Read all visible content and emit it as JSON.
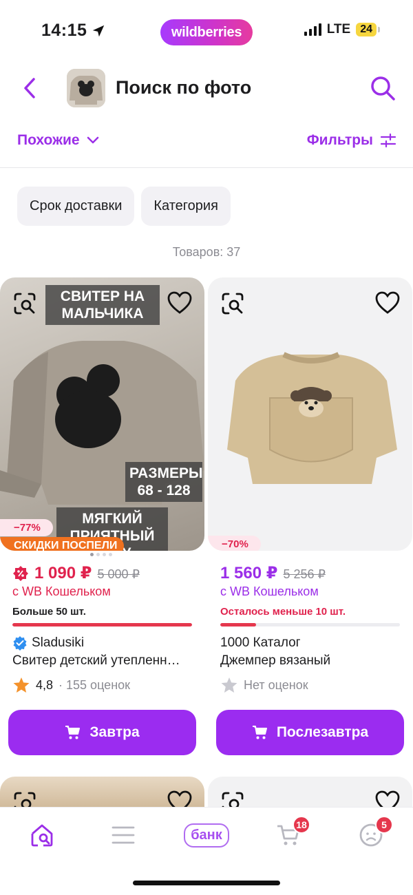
{
  "status_bar": {
    "time": "14:15",
    "network": "LTE",
    "battery": "24"
  },
  "brand": {
    "name": "wildberries",
    "accent": "#9b2ee8"
  },
  "header": {
    "title": "Поиск по фото"
  },
  "toolbar": {
    "similar_label": "Похожие",
    "filters_label": "Фильтры"
  },
  "chips": [
    "Срок доставки",
    "Категория"
  ],
  "count_text": "Товаров: 37",
  "products": [
    {
      "overlay_top": "СВИТЕР НА МАЛЬЧИКА",
      "overlay_sizes_title": "РАЗМЕРЫ",
      "overlay_sizes": "68 - 128",
      "overlay_bottom": "МЯГКИЙ ПРИЯТНЫЙ ТЕЛУ",
      "discount": "−77%",
      "promo": "СКИДКИ ПОСПЕЛИ",
      "price": "1 090 ₽",
      "old_price": "5 000 ₽",
      "wallet": "с WB Кошельком",
      "stock": "Больше 50 шт.",
      "stock_level": 1.0,
      "seller": "Sladusiki",
      "name": "Свитер детский утепленн…",
      "rating": "4,8",
      "reviews": "· 155 оценок",
      "button": "Завтра"
    },
    {
      "discount": "−70%",
      "price": "1 560 ₽",
      "old_price": "5 256 ₽",
      "wallet": "с WB Кошельком",
      "stock": "Осталось меньше 10 шт.",
      "stock_level": 0.2,
      "seller": "1000 Каталог",
      "name": "Джемпер вязаный",
      "rating_text": "Нет оценок",
      "button": "Послезавтра"
    }
  ],
  "tabbar": {
    "bank_label": "банк",
    "cart_badge": "18",
    "profile_badge": "5"
  },
  "colors": {
    "price_red": "#e0224d",
    "price_purple": "#9b2ee8",
    "stock_bar": "#e5374d",
    "button": "#9b2cf0",
    "promo": "#f0711f"
  }
}
